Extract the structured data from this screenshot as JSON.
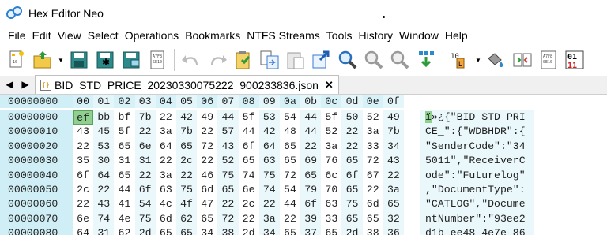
{
  "window": {
    "title": "Hex Editor Neo"
  },
  "menu": [
    "File",
    "Edit",
    "View",
    "Select",
    "Operations",
    "Bookmarks",
    "NTFS Streams",
    "Tools",
    "History",
    "Window",
    "Help"
  ],
  "toolbar": {
    "icons": [
      "new-file-icon",
      "open-file-icon",
      "save-icon",
      "save-all-icon",
      "save-as-icon",
      "print-icon",
      "undo-icon",
      "redo-icon",
      "clipboard-paste-icon",
      "copy-to-file-icon",
      "paste-from-file-icon",
      "export-icon",
      "find-icon",
      "find-next-icon",
      "find-previous-icon",
      "download-icon",
      "insert-mode-icon",
      "fill-icon",
      "bit-operations-icon",
      "structure-icon",
      "binary-view-icon"
    ]
  },
  "tabs": [
    {
      "label": "BID_STD_PRICE_20230330075222_900233836.json",
      "icon": "{}"
    }
  ],
  "hex": {
    "header_offset": "00000000",
    "columns": [
      "00",
      "01",
      "02",
      "03",
      "04",
      "05",
      "06",
      "07",
      "08",
      "09",
      "0a",
      "0b",
      "0c",
      "0d",
      "0e",
      "0f"
    ],
    "rows": [
      {
        "offset": "00000000",
        "bytes": [
          "ef",
          "bb",
          "bf",
          "7b",
          "22",
          "42",
          "49",
          "44",
          "5f",
          "53",
          "54",
          "44",
          "5f",
          "50",
          "52",
          "49"
        ],
        "ascii_cur": "ï",
        "ascii": "»¿{\"BID_STD_PRI"
      },
      {
        "offset": "00000010",
        "bytes": [
          "43",
          "45",
          "5f",
          "22",
          "3a",
          "7b",
          "22",
          "57",
          "44",
          "42",
          "48",
          "44",
          "52",
          "22",
          "3a",
          "7b"
        ],
        "ascii_cur": "",
        "ascii": "CE_\":{\"WDBHDR\":{"
      },
      {
        "offset": "00000020",
        "bytes": [
          "22",
          "53",
          "65",
          "6e",
          "64",
          "65",
          "72",
          "43",
          "6f",
          "64",
          "65",
          "22",
          "3a",
          "22",
          "33",
          "34"
        ],
        "ascii_cur": "",
        "ascii": "\"SenderCode\":\"34"
      },
      {
        "offset": "00000030",
        "bytes": [
          "35",
          "30",
          "31",
          "31",
          "22",
          "2c",
          "22",
          "52",
          "65",
          "63",
          "65",
          "69",
          "76",
          "65",
          "72",
          "43"
        ],
        "ascii_cur": "",
        "ascii": "5011\",\"ReceiverC"
      },
      {
        "offset": "00000040",
        "bytes": [
          "6f",
          "64",
          "65",
          "22",
          "3a",
          "22",
          "46",
          "75",
          "74",
          "75",
          "72",
          "65",
          "6c",
          "6f",
          "67",
          "22"
        ],
        "ascii_cur": "",
        "ascii": "ode\":\"Futurelog\""
      },
      {
        "offset": "00000050",
        "bytes": [
          "2c",
          "22",
          "44",
          "6f",
          "63",
          "75",
          "6d",
          "65",
          "6e",
          "74",
          "54",
          "79",
          "70",
          "65",
          "22",
          "3a"
        ],
        "ascii_cur": "",
        "ascii": ",\"DocumentType\":"
      },
      {
        "offset": "00000060",
        "bytes": [
          "22",
          "43",
          "41",
          "54",
          "4c",
          "4f",
          "47",
          "22",
          "2c",
          "22",
          "44",
          "6f",
          "63",
          "75",
          "6d",
          "65"
        ],
        "ascii_cur": "",
        "ascii": "\"CATLOG\",\"Docume"
      },
      {
        "offset": "00000070",
        "bytes": [
          "6e",
          "74",
          "4e",
          "75",
          "6d",
          "62",
          "65",
          "72",
          "22",
          "3a",
          "22",
          "39",
          "33",
          "65",
          "65",
          "32"
        ],
        "ascii_cur": "",
        "ascii": "ntNumber\":\"93ee2"
      },
      {
        "offset": "00000080",
        "bytes": [
          "64",
          "31",
          "62",
          "2d",
          "65",
          "65",
          "34",
          "38",
          "2d",
          "34",
          "65",
          "37",
          "65",
          "2d",
          "38",
          "36"
        ],
        "ascii_cur": "",
        "ascii": "d1b-ee48-4e7e-86"
      }
    ]
  },
  "colors": {
    "offset_bg": "#cfeef5",
    "alt_col_bg": "#eaf8fb",
    "selection": "#8fcf8f"
  }
}
